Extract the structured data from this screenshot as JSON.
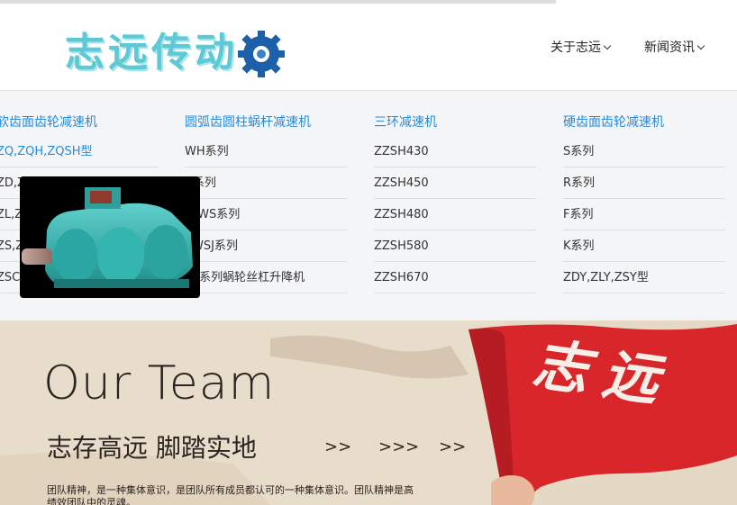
{
  "brand": {
    "logo_text": "志远传动"
  },
  "nav": [
    {
      "label": "关于志远"
    },
    {
      "label": "新闻资讯"
    }
  ],
  "mega_menu": {
    "columns": [
      {
        "heading": "软齿面齿轮减速机",
        "items": [
          "ZQ,ZQH,ZQSH型",
          "ZD,Z",
          "ZL,Z",
          "ZS,Z",
          "ZSC"
        ]
      },
      {
        "heading": "圆弧齿圆柱蜗杆减速机",
        "items": [
          "WH系列",
          "V系列",
          "D,WS系列",
          "J,WSJ系列",
          "VL系列蜗轮丝杠升降机"
        ]
      },
      {
        "heading": "三环减速机",
        "items": [
          "ZZSH430",
          "ZZSH450",
          "ZZSH480",
          "ZZSH580",
          "ZZSH670"
        ]
      },
      {
        "heading": "硬齿面齿轮减速机",
        "items": [
          "S系列",
          "R系列",
          "F系列",
          "K系列",
          "ZDY,ZLY,ZSY型"
        ]
      }
    ]
  },
  "banner": {
    "title": "Our Team",
    "subtitle": "志存高远  脚踏实地",
    "arrows": [
      ">>",
      ">>>",
      ">>"
    ],
    "description": "团队精神，是一种集体意识，是团队所有成员都认可的一种集体意识。团队精神是高绩效团队中的灵魂。",
    "flag_text": "志远"
  },
  "colors": {
    "accent": "#2a8bd8",
    "logo": "#5ec8d4",
    "flag": "#d8262b",
    "menu_bg": "#f4f5f7"
  }
}
